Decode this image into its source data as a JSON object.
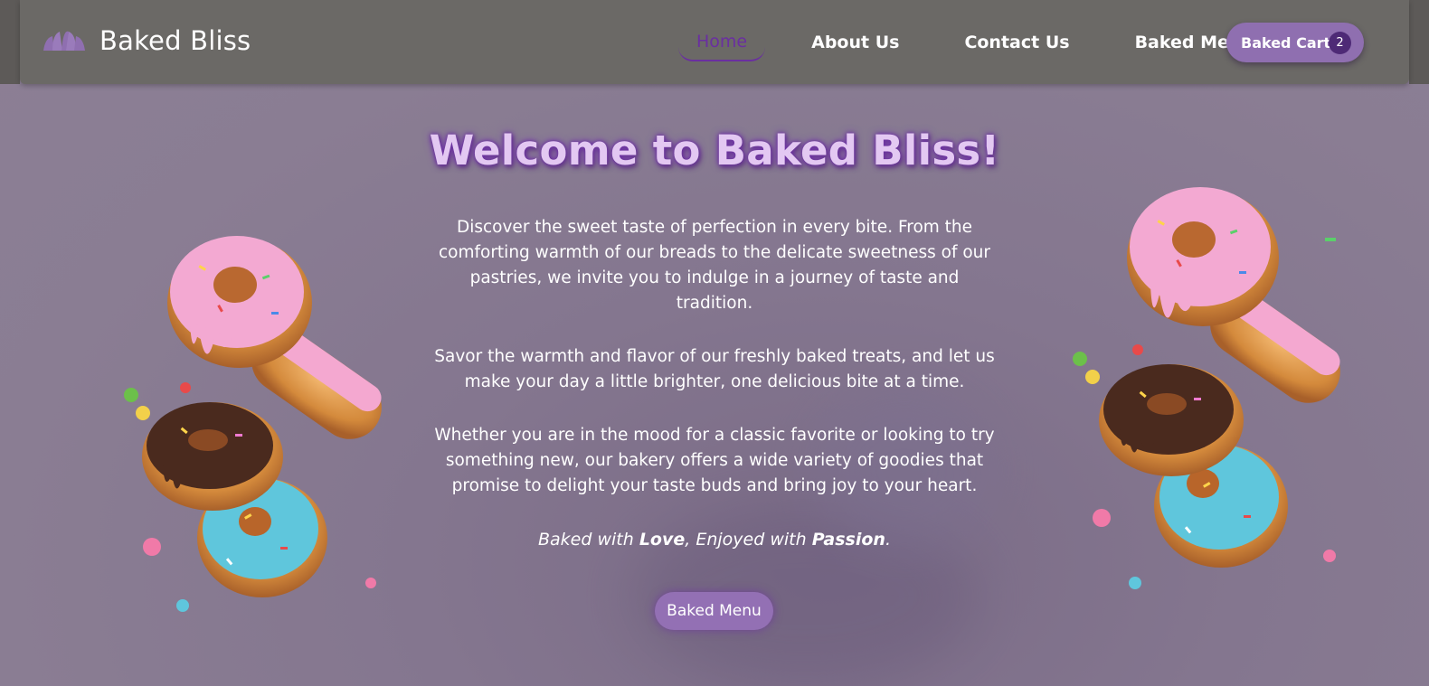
{
  "brand": {
    "name": "Baked Bliss",
    "logo_icon": "croissant-icon"
  },
  "nav": {
    "items": [
      {
        "label": "Home",
        "active": true
      },
      {
        "label": "About Us",
        "active": false
      },
      {
        "label": "Contact Us",
        "active": false
      },
      {
        "label": "Baked Menu",
        "active": false
      }
    ],
    "cart": {
      "label": "Baked Cart",
      "count": "2"
    }
  },
  "hero": {
    "title": "Welcome to Baked Bliss!",
    "paragraphs": [
      "Discover the sweet taste of perfection in every bite. From the comforting warmth of our breads to the delicate sweetness of our pastries, we invite you to indulge in a journey of taste and tradition.",
      "Savor the warmth and flavor of our freshly baked treats, and let us make your day a little brighter, one delicious bite at a time.",
      "Whether you are in the mood for a classic favorite or looking to try something new, our bakery offers a wide variety of goodies that promise to delight your taste buds and bring joy to your heart."
    ],
    "tagline": {
      "prefix": "Baked with ",
      "word1": "Love",
      "middle": ", Enjoyed with ",
      "word2": "Passion",
      "suffix": "."
    },
    "cta_label": "Baked Menu"
  },
  "images": {
    "left": "donut-stack-image",
    "right": "donut-stack-image"
  },
  "colors": {
    "navbar": "#6b6966",
    "background": "#8a7d93",
    "accent": "#8f6fb0",
    "active_link": "#6a2fa0",
    "badge": "#4e2a76",
    "title": "#e3c8f2"
  }
}
